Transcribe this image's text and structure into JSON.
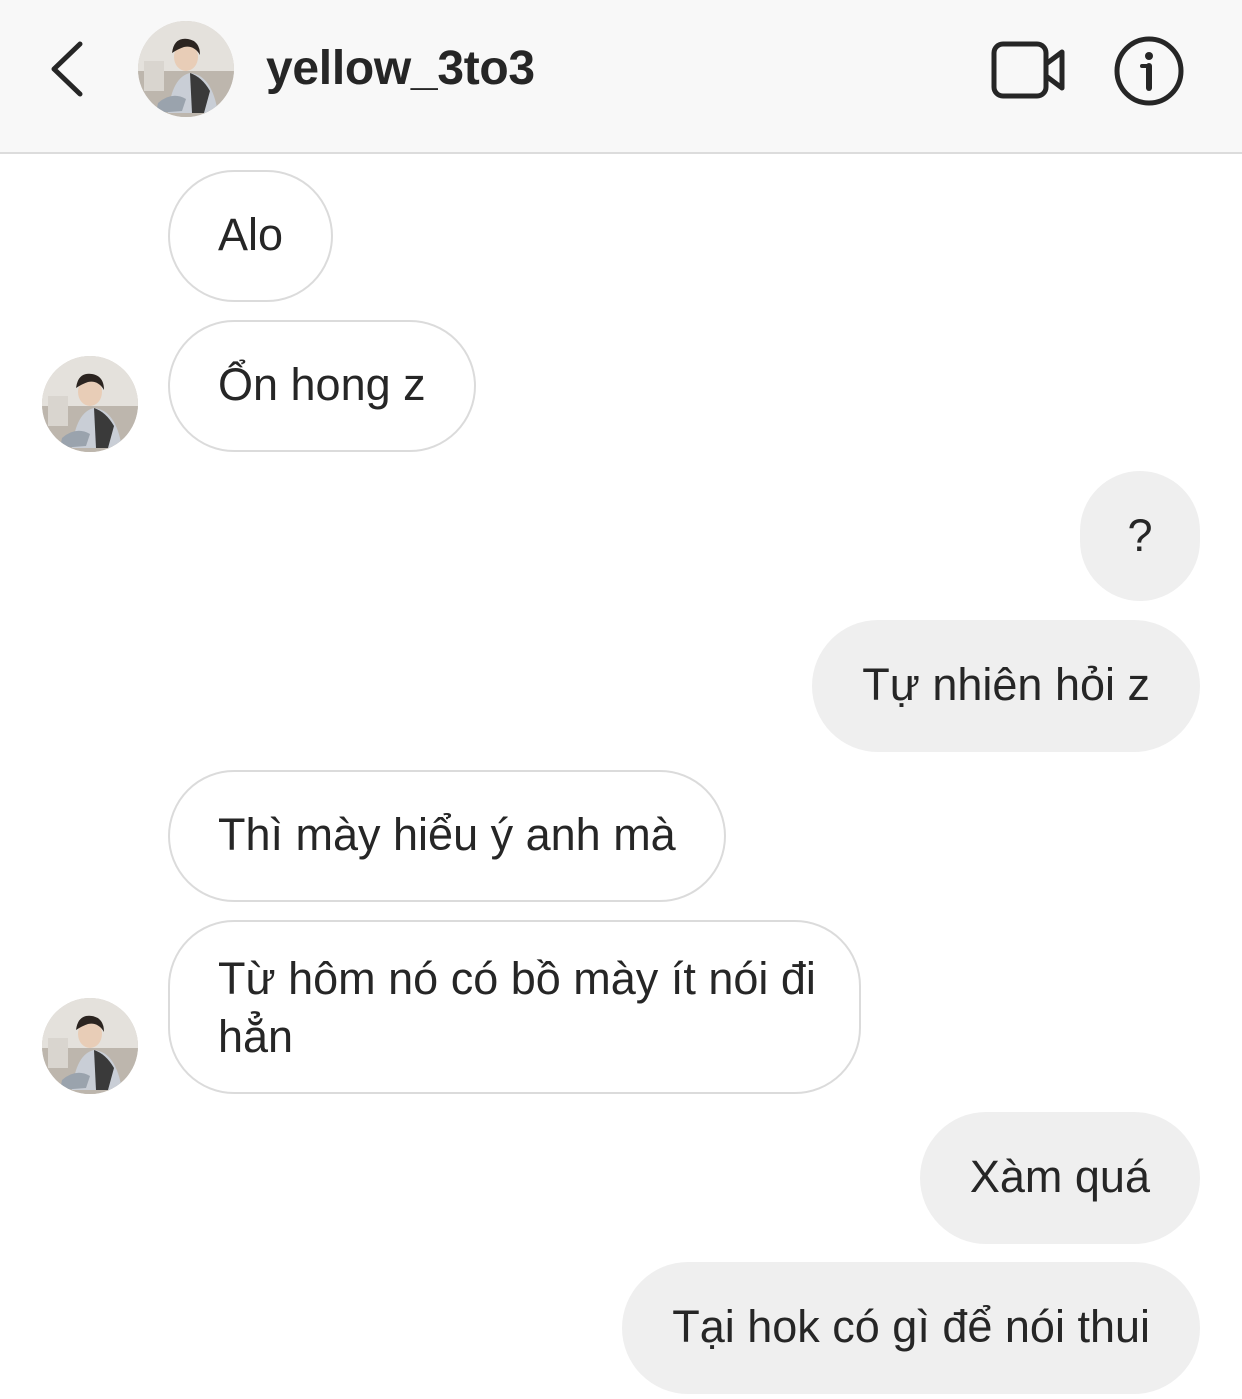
{
  "header": {
    "username": "yellow_3to3",
    "back_icon": "chevron-left-icon",
    "video_icon": "video-camera-icon",
    "info_icon": "info-icon"
  },
  "messages": [
    {
      "side": "in",
      "text": "Alo"
    },
    {
      "side": "in",
      "text": "Ổn hong z"
    },
    {
      "side": "out",
      "text": "?"
    },
    {
      "side": "out",
      "text": "Tự nhiên hỏi z"
    },
    {
      "side": "in",
      "text": "Thì mày hiểu ý anh mà"
    },
    {
      "side": "in",
      "text": "Từ hôm nó có bồ mày ít nói đi hẳn"
    },
    {
      "side": "out",
      "text": "Xàm quá"
    },
    {
      "side": "out",
      "text": "Tại hok có gì để nói thui"
    }
  ],
  "colors": {
    "header_bg": "#f8f8f8",
    "incoming_bubble_border": "#dbdbdb",
    "outgoing_bubble_bg": "#efefef",
    "text": "#262626"
  }
}
